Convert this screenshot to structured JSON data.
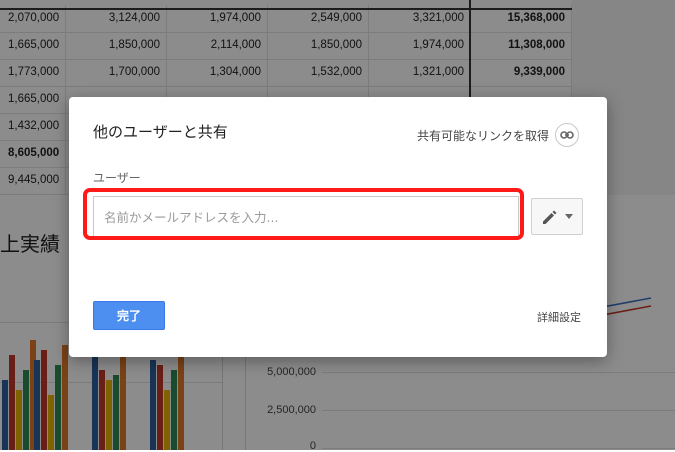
{
  "sheet": {
    "rows": [
      [
        "2,070,000",
        "3,124,000",
        "1,974,000",
        "2,549,000",
        "3,321,000",
        "15,368,000"
      ],
      [
        "1,665,000",
        "1,850,000",
        "2,114,000",
        "1,850,000",
        "1,974,000",
        "11,308,000"
      ],
      [
        "1,773,000",
        "1,700,000",
        "1,304,000",
        "1,532,000",
        "1,321,000",
        "9,339,000"
      ],
      [
        "1,665,000",
        "",
        "",
        "",
        "",
        ""
      ],
      [
        "1,432,000",
        "",
        "",
        "",
        "",
        ""
      ],
      [
        "8,605,000",
        "",
        "",
        "",
        "",
        ""
      ],
      [
        "9,445,000",
        "",
        "",
        "",
        "",
        ""
      ]
    ],
    "bold_rows": [
      5
    ],
    "chart_title_partial": "上実績",
    "y_ticks": [
      "5,000,000",
      "2,500,000",
      "0"
    ],
    "bar_colors": [
      "#2f5f9e",
      "#c0392b",
      "#e6b400",
      "#2e8b57",
      "#e0782a"
    ]
  },
  "dialog": {
    "title": "他のユーザーと共有",
    "share_link_label": "共有可能なリンクを取得",
    "section_label": "ユーザー",
    "input_placeholder": "名前かメールアドレスを入力...",
    "input_value": "",
    "done_label": "完了",
    "advanced_label": "詳細設定",
    "highlight_color": "#ff1a1a",
    "primary_color": "#4d8ff1"
  }
}
